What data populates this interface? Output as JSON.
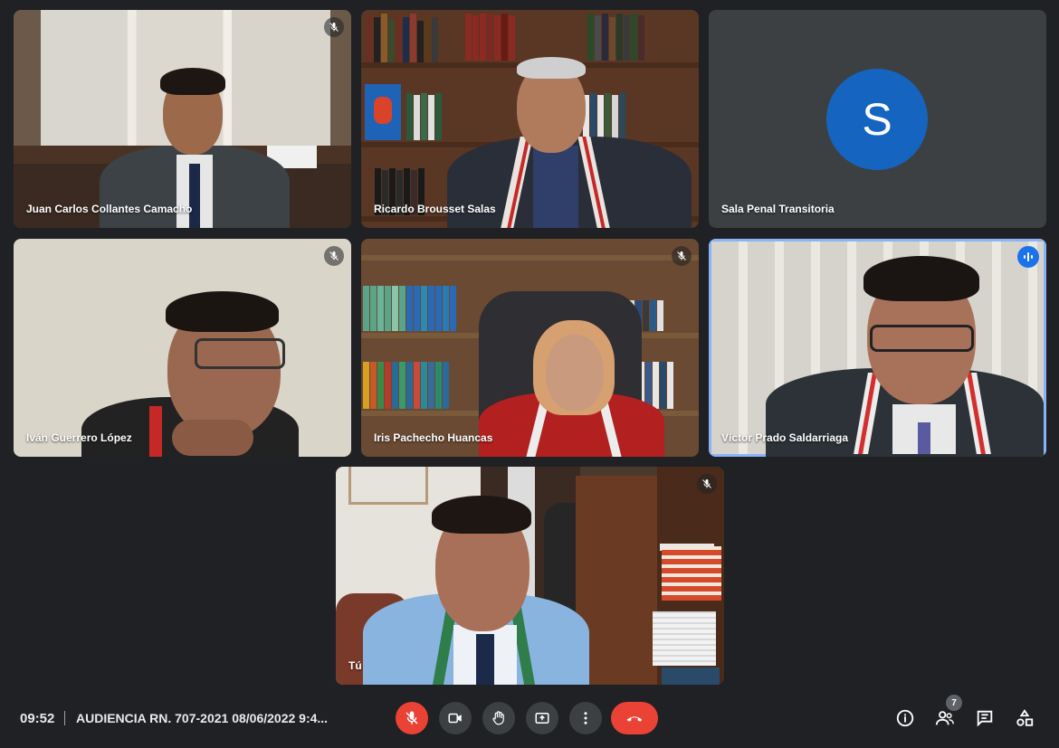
{
  "participants": [
    {
      "name": "Juan Carlos Collantes Camacho",
      "muted": true
    },
    {
      "name": "Ricardo Brousset Salas",
      "muted": false
    },
    {
      "name": "Sala Penal Transitoria",
      "avatar_letter": "S",
      "avatar_color": "#1565c0"
    },
    {
      "name": "Iván Guerrero López",
      "muted": true
    },
    {
      "name": "Iris Pachecho Huancas",
      "muted": true
    },
    {
      "name": "Víctor Prado Saldarriaga",
      "speaking": true
    },
    {
      "name": "Tú",
      "muted": true
    }
  ],
  "bottom_bar": {
    "time": "09:52",
    "meeting_title": "AUDIENCIA RN. 707-2021 08/06/2022 9:4...",
    "people_count": "7"
  },
  "colors": {
    "background": "#202124",
    "tile": "#3c4043",
    "danger": "#ea4335",
    "accent": "#1a73e8"
  },
  "icons": [
    "mic-off-icon",
    "camera-icon",
    "raise-hand-icon",
    "present-icon",
    "more-icon",
    "end-call-icon",
    "info-icon",
    "people-icon",
    "chat-icon",
    "activities-icon",
    "audio-wave-icon"
  ]
}
